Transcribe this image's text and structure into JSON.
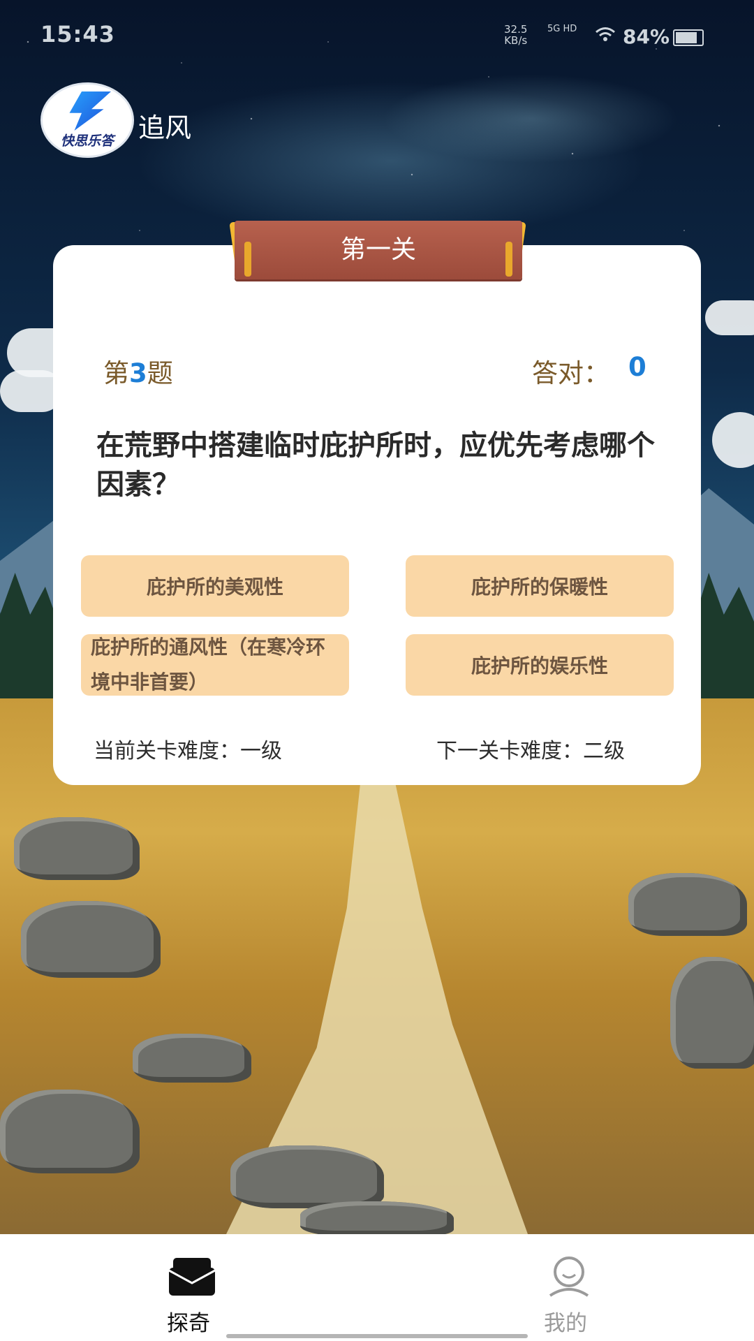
{
  "status_bar": {
    "time": "15:43",
    "speed_value": "32.5",
    "speed_unit": "KB/s",
    "network": "5G HD",
    "battery_text": "84%",
    "battery_level": 0.84
  },
  "header": {
    "logo_text": "快思乐答",
    "username": "追风"
  },
  "quiz": {
    "level_title": "第一关",
    "question_prefix": "第",
    "question_number": "3",
    "question_suffix": "题",
    "correct_label": "答对：",
    "correct_count": "0",
    "question_text": "在荒野中搭建临时庇护所时，应优先考虑哪个因素？",
    "options": [
      "庇护所的美观性",
      "庇护所的保暖性",
      "庇护所的通风性（在寒冷环境中非首要）",
      "庇护所的娱乐性"
    ],
    "current_difficulty": "当前关卡难度：一级",
    "next_difficulty": "下一关卡难度：二级"
  },
  "nav": {
    "items": [
      {
        "label": "探奇",
        "icon": "explore-icon",
        "active": true
      },
      {
        "label": "我的",
        "icon": "profile-icon",
        "active": false
      }
    ],
    "active_color": "#111111",
    "inactive_color": "#9a9a9a"
  },
  "colors": {
    "accent_blue": "#1d7ed6",
    "option_bg": "#fad7a6",
    "ribbon": "#a95443"
  }
}
